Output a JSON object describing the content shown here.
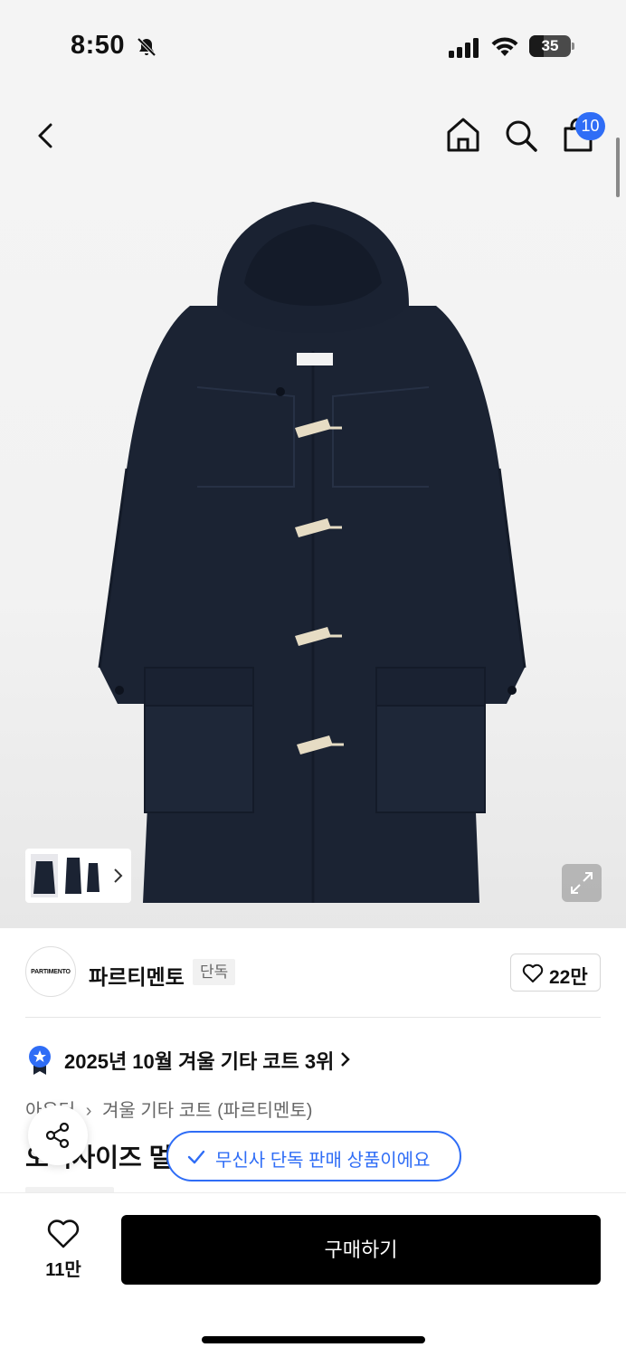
{
  "status_bar": {
    "time": "8:50",
    "battery_level": 35,
    "battery_text": "35"
  },
  "nav": {
    "cart_count": "10",
    "icons": [
      "back-icon",
      "home-icon",
      "search-icon",
      "cart-icon"
    ]
  },
  "brand": {
    "logo_text": "PARTIMENTO",
    "name": "파르티멘토",
    "tag": "단독",
    "like_count": "22만"
  },
  "ranking": {
    "text": "2025년 10월 겨울 기타 코트 3위"
  },
  "breadcrumb": {
    "items": [
      "아우터",
      "겨울 기타 코트 (파르티멘토)"
    ]
  },
  "product": {
    "title_partial": "오버사이즈 멀"
  },
  "exclusive_notice": "무신사 단독 판매 상품이에요",
  "bottom": {
    "wish_count": "11만",
    "buy_label": "구매하기"
  },
  "colors": {
    "accent_blue": "#2f6df6",
    "coat_navy": "#1b2333",
    "toggle_beige": "#e6dcc4"
  }
}
